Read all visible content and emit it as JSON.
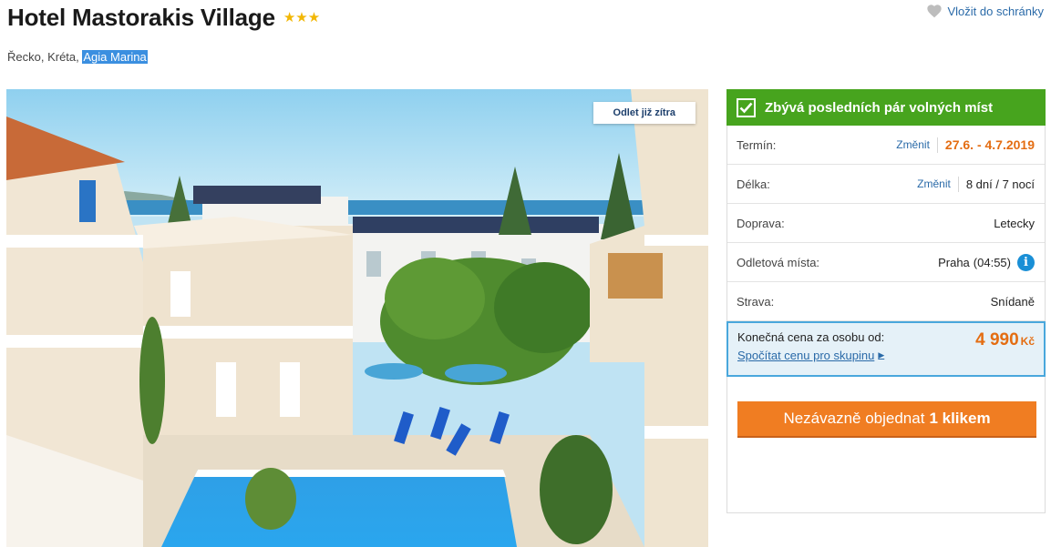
{
  "header": {
    "hotel_name": "Hotel Mastorakis Village",
    "stars": "★★★",
    "star_count": 3,
    "save_label": "Vložit do schránky",
    "location_prefix": "Řecko, Kréta, ",
    "location_highlight": "Agia Marina"
  },
  "photo": {
    "badge": "Odlet již zítra"
  },
  "panel": {
    "availability": "Zbývá posledních pár volných míst",
    "rows": [
      {
        "label": "Termín:",
        "change": "Změnit",
        "value": "27.6. - 4.7.2019"
      },
      {
        "label": "Délka:",
        "change": "Změnit",
        "value": "8 dní / 7 nocí"
      },
      {
        "label": "Doprava:",
        "value": "Letecky"
      },
      {
        "label": "Odletová místa:",
        "value": "Praha",
        "time": "(04:55)"
      },
      {
        "label": "Strava:",
        "value": "Snídaně"
      }
    ],
    "price_label": "Konečná cena za osobu od:",
    "price_value": "4 990",
    "price_currency": "Kč",
    "group_link": "Spočítat cenu pro skupinu",
    "order_button_prefix": "Nezávazně objednat",
    "order_button_bold": "1 klikem"
  },
  "colors": {
    "green": "#47a41e",
    "orange": "#f07d22",
    "price_orange": "#e46d12",
    "link_blue": "#2a6aa8",
    "info_blue": "#1a8fd6",
    "star_gold": "#f2b705"
  },
  "icons": {
    "save": "heart-icon",
    "availability": "checkbox-check-icon",
    "info": "info-icon",
    "group_link": "caret-right-icon"
  }
}
